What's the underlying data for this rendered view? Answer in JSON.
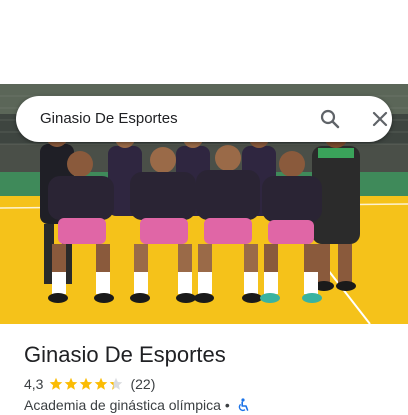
{
  "search": {
    "query": "Ginasio De Esportes"
  },
  "place": {
    "title": "Ginasio De Esportes",
    "rating": "4,3",
    "rating_value": 4.3,
    "reviews": "(22)",
    "category": "Academia de ginástica olímpica",
    "separator": "•"
  },
  "icons": {
    "search": "search-icon",
    "close": "close-icon",
    "star": "star-icon",
    "accessibility": "wheelchair-accessible-icon"
  },
  "colors": {
    "star": "#fbbc04",
    "star_empty": "#dadce0",
    "accessibility": "#1a73e8",
    "court": "#f5c21a",
    "jersey": "#2a2434",
    "shorts": "#e066a6"
  }
}
